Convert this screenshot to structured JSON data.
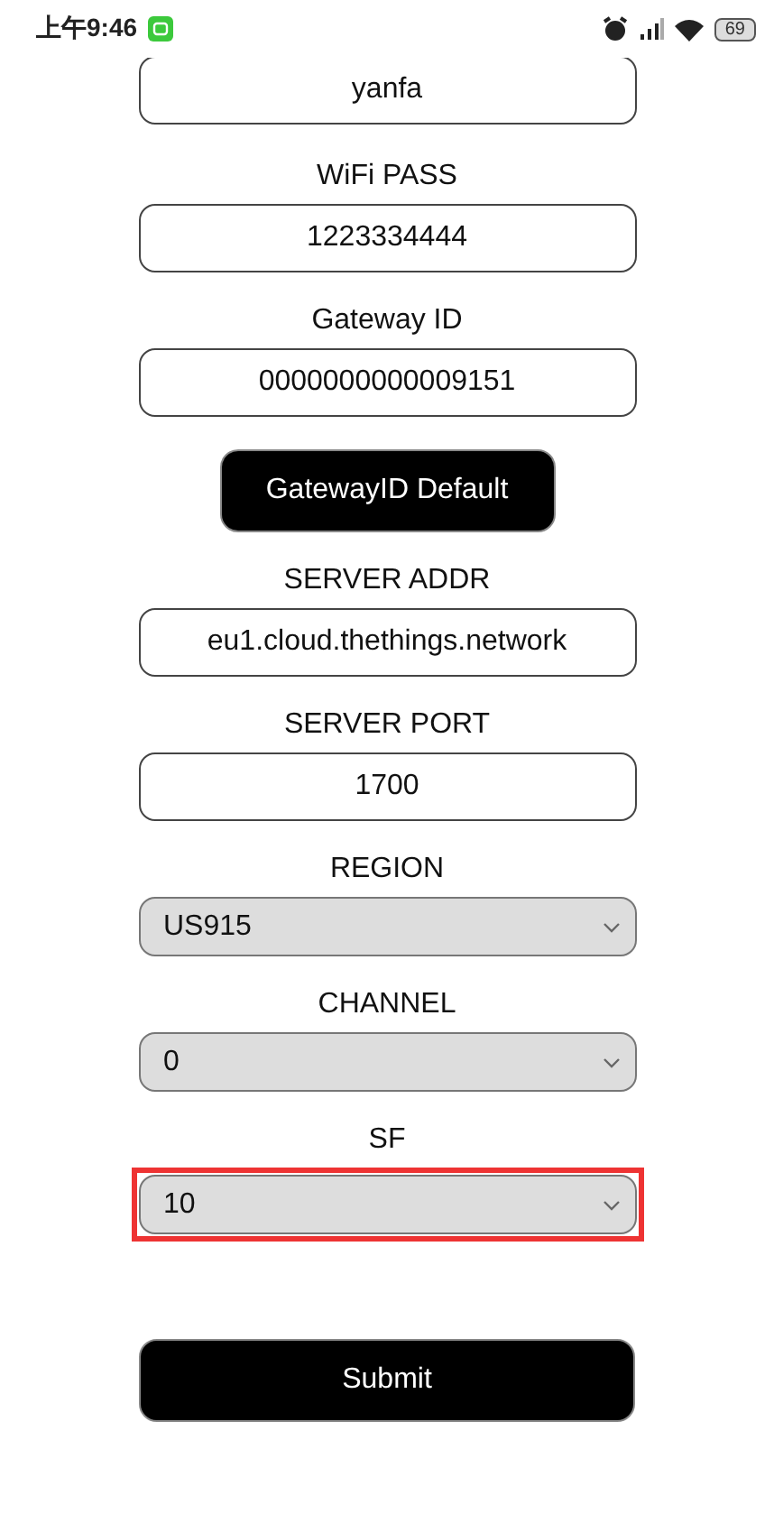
{
  "status_bar": {
    "time": "上午9:46",
    "battery": "69"
  },
  "fields": [
    {
      "kind": "input",
      "value": "yanfa",
      "highlighted": false
    },
    {
      "kind": "input",
      "label": "WiFi PASS",
      "value": "1223334444",
      "highlighted": false
    },
    {
      "kind": "input",
      "label": "Gateway ID",
      "value": "0000000000009151",
      "highlighted": false
    },
    {
      "kind": "button",
      "label": "GatewayID Default"
    },
    {
      "kind": "input",
      "label": "SERVER ADDR",
      "value": "eu1.cloud.thethings.network",
      "highlighted": false
    },
    {
      "kind": "input",
      "label": "SERVER PORT",
      "value": "1700",
      "highlighted": false
    },
    {
      "kind": "select",
      "label": "REGION",
      "value": "US915",
      "highlighted": false
    },
    {
      "kind": "select",
      "label": "CHANNEL",
      "value": "0",
      "highlighted": false
    },
    {
      "kind": "select",
      "label": "SF",
      "value": "10",
      "highlighted": true
    }
  ],
  "submit": "Submit"
}
